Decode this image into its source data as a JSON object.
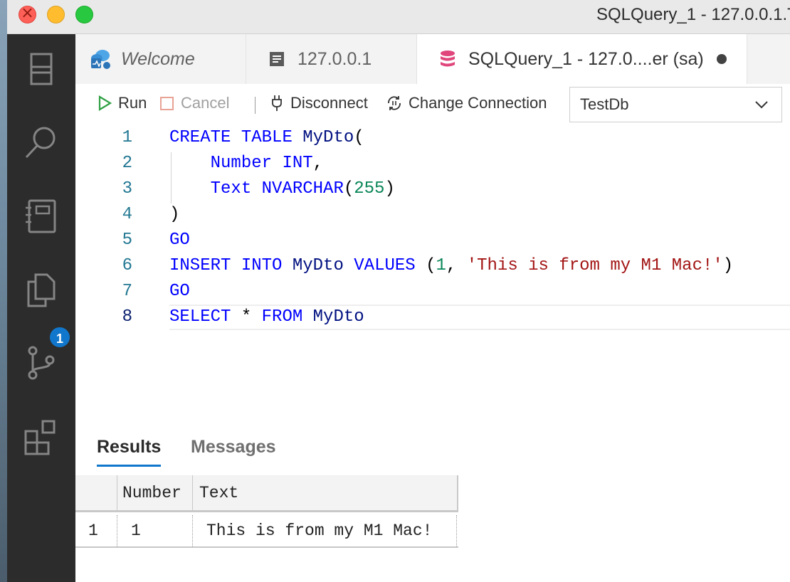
{
  "window": {
    "title": "SQLQuery_1 - 127.0.0.1.T"
  },
  "activity_bar": {
    "notification_badge": "1"
  },
  "tabs": [
    {
      "label": "Welcome"
    },
    {
      "label": "127.0.0.1"
    },
    {
      "label": "SQLQuery_1 - 127.0....er (sa)"
    }
  ],
  "toolbar": {
    "run_label": "Run",
    "cancel_label": "Cancel",
    "disconnect_label": "Disconnect",
    "change_connection_label": "Change Connection",
    "database": "TestDb"
  },
  "editor": {
    "line_numbers": [
      "1",
      "2",
      "3",
      "4",
      "5",
      "6",
      "7",
      "8"
    ],
    "lines": [
      "CREATE TABLE MyDto(",
      "    Number INT,",
      "    Text NVARCHAR(255)",
      ")",
      "GO",
      "INSERT INTO MyDto VALUES (1, 'This is from my M1 Mac!')",
      "GO",
      "SELECT * FROM MyDto"
    ]
  },
  "results": {
    "tabs": [
      "Results",
      "Messages"
    ],
    "columns": [
      "Number",
      "Text"
    ],
    "rows": [
      {
        "row_number": "1",
        "cells": [
          "1",
          "This is from my M1 Mac!"
        ]
      }
    ]
  }
}
